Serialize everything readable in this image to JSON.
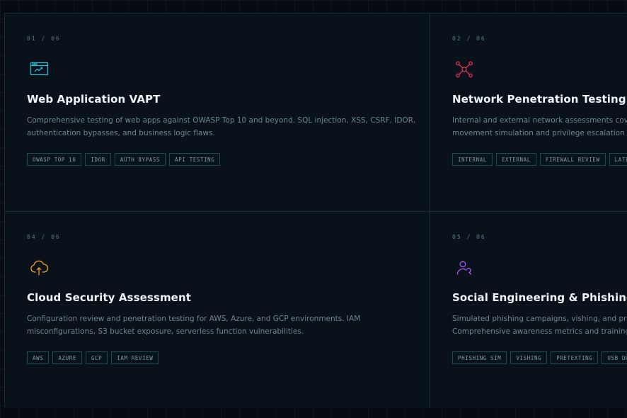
{
  "cards": [
    {
      "index": "01 / 06",
      "icon": "browser-chart-icon",
      "icon_color": "#22b8cf",
      "title": "Web Application VAPT",
      "desc_lines": [
        "Comprehensive testing of web apps against OWASP Top 10 and beyond. SQL injection, XSS, CSRF, IDOR,",
        "authentication bypasses, and business logic flaws."
      ],
      "tags": [
        "OWASP TOP 10",
        "IDOR",
        "AUTH BYPASS",
        "API TESTING"
      ]
    },
    {
      "index": "02 / 06",
      "icon": "network-nodes-icon",
      "icon_color": "#e0314f",
      "title": "Network Penetration Testing",
      "desc_lines": [
        "Internal and external network assessments cover",
        "movement simulation and privilege escalation tes"
      ],
      "tags": [
        "INTERNAL",
        "EXTERNAL",
        "FIREWALL REVIEW",
        "LATERAL"
      ]
    },
    {
      "index": "04 / 06",
      "icon": "cloud-upload-icon",
      "icon_color": "#f0a020",
      "title": "Cloud Security Assessment",
      "desc_lines": [
        "Configuration review and penetration testing for AWS, Azure, and GCP environments. IAM",
        "misconfigurations, S3 bucket exposure, serverless function vulnerabilities."
      ],
      "tags": [
        "AWS",
        "AZURE",
        "GCP",
        "IAM REVIEW"
      ]
    },
    {
      "index": "05 / 06",
      "icon": "user-phish-icon",
      "icon_color": "#a855f7",
      "title": "Social Engineering & Phishing",
      "desc_lines": [
        "Simulated phishing campaigns, vishing, and prete",
        "Comprehensive awareness metrics and training re"
      ],
      "tags": [
        "PHISHING SIM",
        "VISHING",
        "PRETEXTING",
        "USB DROP"
      ]
    }
  ]
}
